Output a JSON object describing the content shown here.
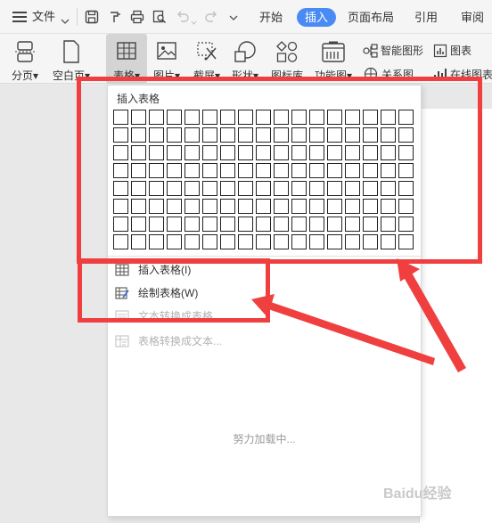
{
  "menubar": {
    "file_label": "文件",
    "tabs": [
      {
        "label": "开始",
        "active": false
      },
      {
        "label": "插入",
        "active": true
      },
      {
        "label": "页面布局",
        "active": false
      },
      {
        "label": "引用",
        "active": false
      },
      {
        "label": "审阅",
        "active": false
      }
    ]
  },
  "ribbon": {
    "buttons": [
      {
        "label": "分页▾",
        "icon": "page-break-icon"
      },
      {
        "label": "空白页▾",
        "icon": "blank-page-icon"
      },
      {
        "label": "表格▾",
        "icon": "table-icon"
      },
      {
        "label": "图片▾",
        "icon": "picture-icon"
      },
      {
        "label": "截屏▾",
        "icon": "screenshot-icon"
      },
      {
        "label": "形状▾",
        "icon": "shapes-icon"
      },
      {
        "label": "图标库",
        "icon": "icon-library-icon"
      },
      {
        "label": "功能图▾",
        "icon": "function-chart-icon"
      }
    ],
    "small": {
      "smartart": "智能图形",
      "chart": "图表",
      "relation": "关系图",
      "online_chart": "在线图表"
    }
  },
  "dropdown": {
    "grid_title": "插入表格",
    "insert_table": "插入表格(I)",
    "draw_table": "绘制表格(W)",
    "text_to_table": "文本转换成表格...",
    "table_to_text": "表格转换成文本...",
    "loading": "努力加载中..."
  },
  "watermark": "Baidu经验",
  "colors": {
    "accent": "#4a8af4",
    "annotation": "#ef3f3f"
  }
}
